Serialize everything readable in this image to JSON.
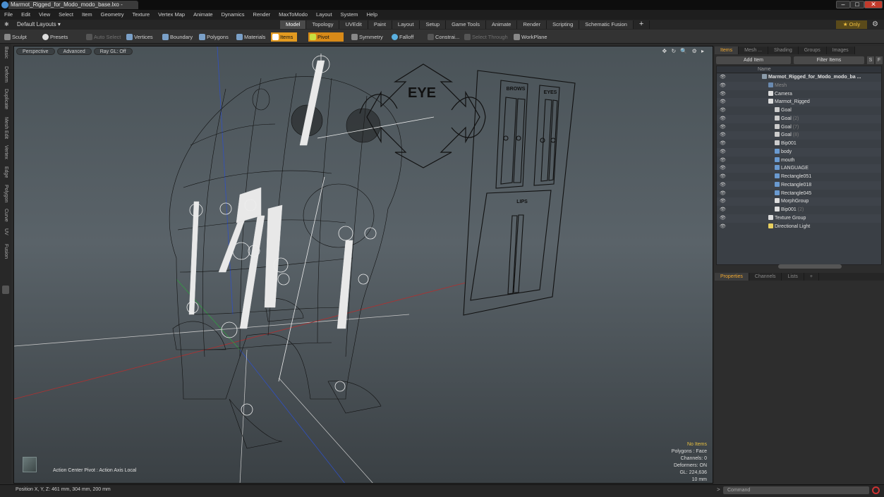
{
  "window": {
    "title": "Marmot_Rigged_for_Modo_modo_base.lxo - MODO",
    "buttons": [
      "–",
      "□",
      "✕"
    ]
  },
  "menu": [
    "File",
    "Edit",
    "View",
    "Select",
    "Item",
    "Geometry",
    "Texture",
    "Vertex Map",
    "Animate",
    "Dynamics",
    "Render",
    "MaxToModo",
    "Layout",
    "System",
    "Help"
  ],
  "layouts": {
    "dropdown": "Default Layouts ▾",
    "tabs": [
      "Model",
      "Topology",
      "UVEdit",
      "Paint",
      "Layout",
      "Setup",
      "Game Tools",
      "Animate",
      "Render",
      "Scripting",
      "Schematic Fusion"
    ],
    "active_tab": "Model",
    "plus": "+",
    "only": "★ Only"
  },
  "toolbar": {
    "sculpt": "Sculpt",
    "presets": "Presets",
    "auto_select": "Auto Select",
    "vertices": "Vertices",
    "boundary": "Boundary",
    "polygons": "Polygons",
    "materials": "Materials",
    "items": "Items",
    "pivot": "Pivot",
    "symmetry": "Symmetry",
    "falloff": "Falloff",
    "constrain": "Constrai...",
    "select_through": "Select Through",
    "workplane": "WorkPlane"
  },
  "left_tabs": [
    "Basic",
    "Deform",
    "Duplicate",
    "Mesh Edit",
    "Vertex",
    "Edge",
    "Polygon",
    "Curve",
    "UV",
    "Fusion"
  ],
  "viewport": {
    "view": "Perspective",
    "shading": "Advanced",
    "raygl": "Ray GL: Off",
    "icons": "✥ ↻ 🔍 ⚙ ▸",
    "info": {
      "selection": "No Items",
      "polygons": "Polygons : Face",
      "channels": "Channels: 0",
      "deformers": "Deformers: ON",
      "gl": "GL: 224,636",
      "scale": "10 mm"
    },
    "action_center": "Action Center Pivot : Action Axis Local",
    "scene_labels": {
      "eye": "EYE",
      "brows": "BROWS",
      "eyes": "EYES",
      "lips": "LIPS"
    }
  },
  "status": {
    "position": "Position X, Y, Z:   461 mm, 304 mm, 200 mm",
    "command_placeholder": "Command",
    "prompt": ">"
  },
  "items_panel": {
    "tabs": [
      "Items",
      "Mesh ...",
      "Shading",
      "Groups",
      "Images"
    ],
    "active_tab": "Items",
    "add_item": "Add Item",
    "filter_items": "Filter Items",
    "s_btn": "S",
    "f_btn": "F",
    "column_name": "Name",
    "rows": [
      {
        "label": "Marmot_Rigged_for_Modo_modo_ba ...",
        "suffix": "",
        "indent": 0,
        "bold": true,
        "dim": false,
        "icon": "#8a9aa8"
      },
      {
        "label": "Mesh",
        "suffix": "",
        "indent": 1,
        "bold": false,
        "dim": true,
        "icon": "#6a8ab0"
      },
      {
        "label": "Camera",
        "suffix": "",
        "indent": 1,
        "bold": false,
        "dim": false,
        "icon": "#dddddd"
      },
      {
        "label": "Marmot_Rigged",
        "suffix": "",
        "indent": 1,
        "bold": false,
        "dim": false,
        "icon": "#dddddd"
      },
      {
        "label": "Goal",
        "suffix": "",
        "indent": 2,
        "bold": false,
        "dim": false,
        "icon": "#cccccc"
      },
      {
        "label": "Goal",
        "suffix": "(2)",
        "indent": 2,
        "bold": false,
        "dim": false,
        "icon": "#cccccc"
      },
      {
        "label": "Goal",
        "suffix": "(7)",
        "indent": 2,
        "bold": false,
        "dim": false,
        "icon": "#cccccc"
      },
      {
        "label": "Goal",
        "suffix": "(8)",
        "indent": 2,
        "bold": false,
        "dim": false,
        "icon": "#cccccc"
      },
      {
        "label": "Bip001",
        "suffix": "",
        "indent": 2,
        "bold": false,
        "dim": false,
        "icon": "#cccccc"
      },
      {
        "label": "body",
        "suffix": "",
        "indent": 2,
        "bold": false,
        "dim": false,
        "icon": "#6a9ad0"
      },
      {
        "label": "mouth",
        "suffix": "",
        "indent": 2,
        "bold": false,
        "dim": false,
        "icon": "#6a9ad0"
      },
      {
        "label": "LANGUAGE",
        "suffix": "",
        "indent": 2,
        "bold": false,
        "dim": false,
        "icon": "#6a9ad0"
      },
      {
        "label": "Rectangle051",
        "suffix": "",
        "indent": 2,
        "bold": false,
        "dim": false,
        "icon": "#6a9ad0"
      },
      {
        "label": "Rectangle018",
        "suffix": "",
        "indent": 2,
        "bold": false,
        "dim": false,
        "icon": "#6a9ad0"
      },
      {
        "label": "Rectangle045",
        "suffix": "",
        "indent": 2,
        "bold": false,
        "dim": false,
        "icon": "#6a9ad0"
      },
      {
        "label": "MorphGroup",
        "suffix": "",
        "indent": 2,
        "bold": false,
        "dim": false,
        "icon": "#dddddd"
      },
      {
        "label": "Bip001",
        "suffix": "(2)",
        "indent": 2,
        "bold": false,
        "dim": false,
        "icon": "#dddddd"
      },
      {
        "label": "Texture Group",
        "suffix": "",
        "indent": 1,
        "bold": false,
        "dim": false,
        "icon": "#dddddd"
      },
      {
        "label": "Directional Light",
        "suffix": "",
        "indent": 1,
        "bold": false,
        "dim": false,
        "icon": "#e8d060"
      }
    ]
  },
  "properties_panel": {
    "tabs": [
      "Properties",
      "Channels",
      "Lists",
      "+"
    ],
    "active_tab": "Properties"
  },
  "colors": {
    "accent": "#e39a20",
    "active_tab_text": "#f0a830",
    "close_button": "#c23a2b"
  }
}
